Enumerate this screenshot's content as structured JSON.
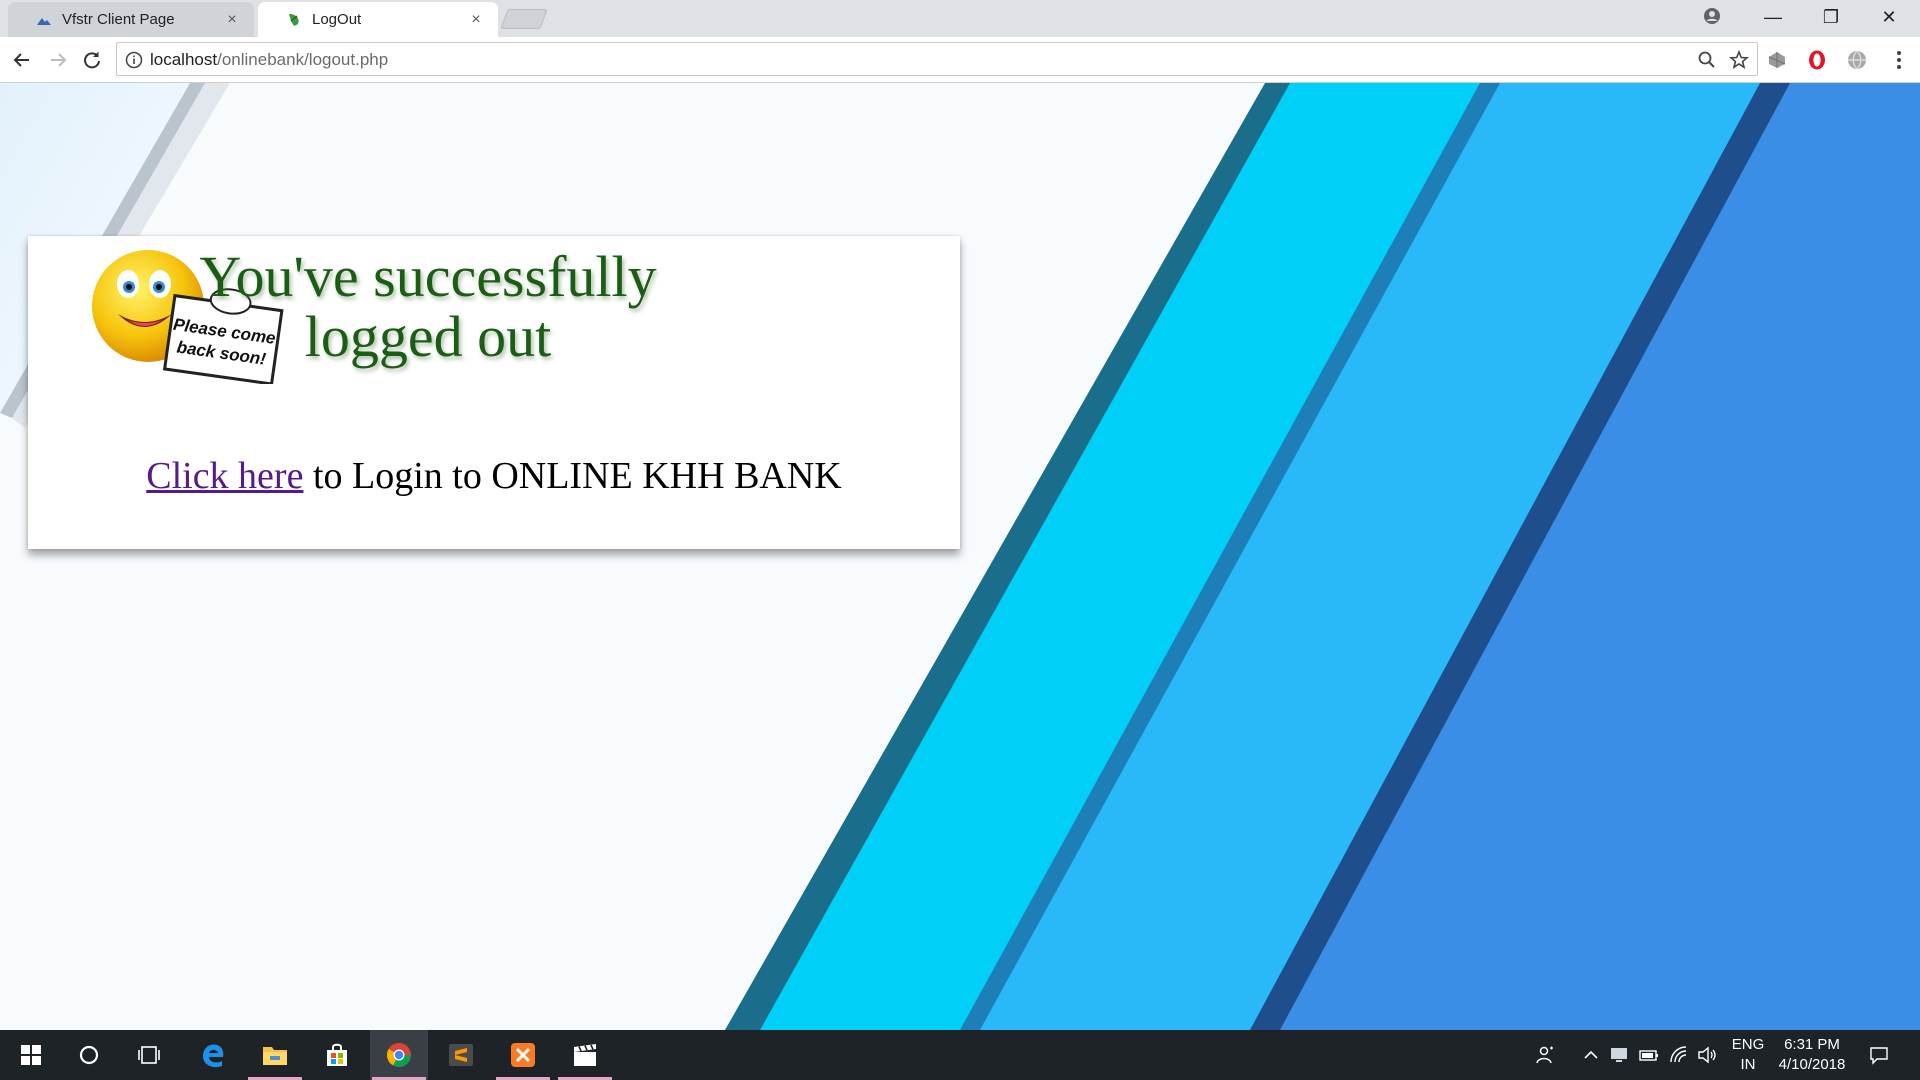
{
  "browser": {
    "tabs": [
      {
        "title": "Vfstr Client Page",
        "favicon": "mountain-favicon",
        "active": false
      },
      {
        "title": "LogOut",
        "favicon": "leaf-favicon",
        "active": true
      }
    ],
    "address": {
      "host": "localhost",
      "path": "/onlinebank/logout.php"
    },
    "tab_close_glyph": "×",
    "window_controls": {
      "minimize": "—",
      "restore": "❐",
      "close": "✕"
    }
  },
  "page": {
    "banner": {
      "headline_line1": "You've successfully",
      "headline_line2": "logged out",
      "sign_line1": "Please come",
      "sign_line2": "back soon!"
    },
    "login_link_text": "Click here",
    "login_rest_text": " to Login to ONLINE KHH BANK"
  },
  "taskbar": {
    "apps": [
      "start-button",
      "cortana-button",
      "task-view-button",
      "edge-app",
      "file-explorer-app",
      "store-app",
      "chrome-app",
      "sublime-app",
      "xampp-app",
      "video-app"
    ],
    "language": {
      "line1": "ENG",
      "line2": "IN"
    },
    "clock": {
      "time": "6:31 PM",
      "date": "4/10/2018"
    }
  },
  "colors": {
    "stripe_cyan": "#00cff8",
    "stripe_sky": "#29b9f8",
    "stripe_blue": "#3a8ee6",
    "headline_green": "#1f5d12",
    "link_visited": "#551a8b"
  }
}
